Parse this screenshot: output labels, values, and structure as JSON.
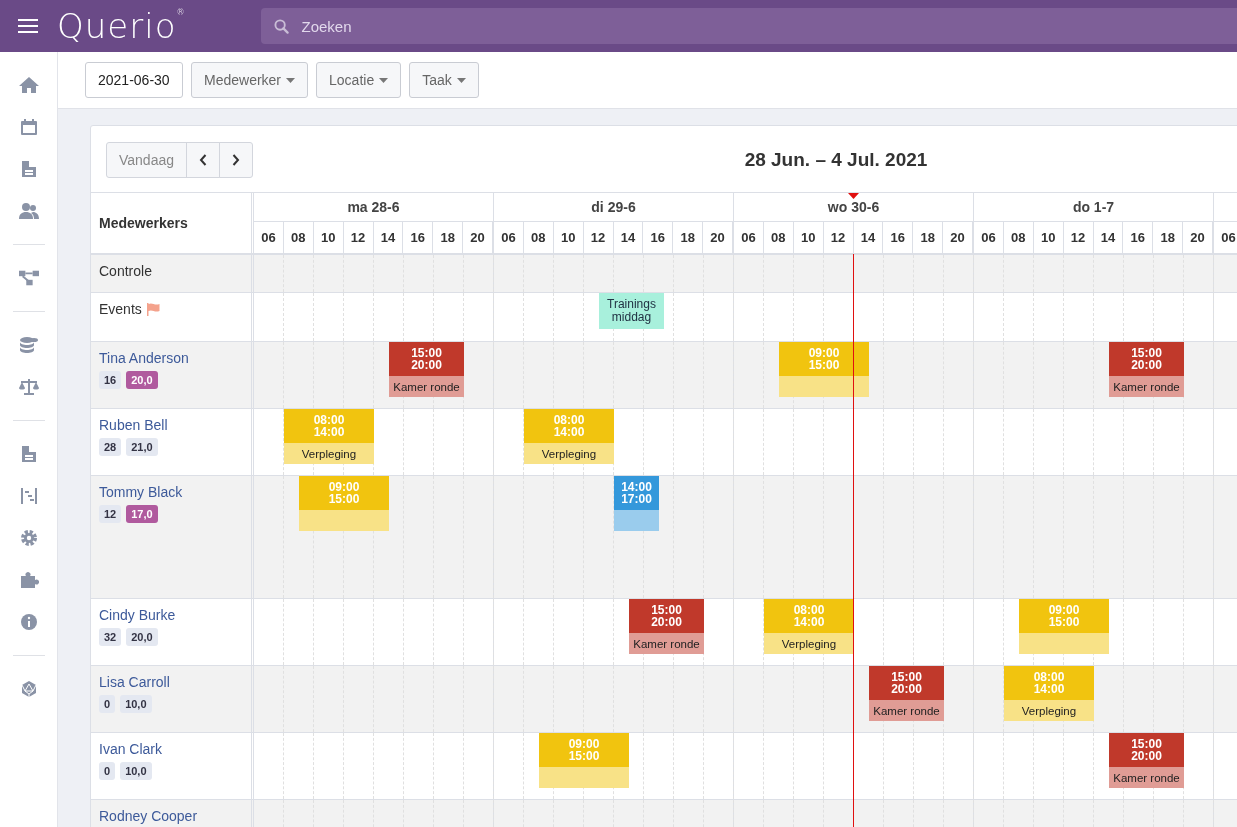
{
  "header": {
    "logo": "Querio$^{®}$",
    "search": {
      "placeholder": "Zoeken"
    }
  },
  "filters": {
    "date": "2021-06-30",
    "dropdowns": [
      "Medewerker",
      "Locatie",
      "Taak"
    ]
  },
  "calendar": {
    "today_button": "Vandaag",
    "title": "28 Jun. – 4 Jul. 2021",
    "name_column": "Medewerkers",
    "days": [
      {
        "label": "ma 28-6",
        "hours": [
          "06",
          "08",
          "10",
          "12",
          "14",
          "16",
          "18",
          "20"
        ]
      },
      {
        "label": "di 29-6",
        "hours": [
          "06",
          "08",
          "10",
          "12",
          "14",
          "16",
          "18",
          "20"
        ]
      },
      {
        "label": "wo 30-6",
        "hours": [
          "06",
          "08",
          "10",
          "12",
          "14",
          "16",
          "18",
          "20"
        ]
      },
      {
        "label": "do 1-7",
        "hours": [
          "06",
          "08",
          "10",
          "12",
          "14",
          "16",
          "18",
          "20"
        ]
      },
      {
        "hours": [
          "06"
        ]
      }
    ],
    "rows": [
      {
        "kind": "plain",
        "name": "Controle"
      },
      {
        "kind": "events",
        "name": "Events",
        "days": [
          {
            "kind": "free"
          },
          {
            "shifts": [
              {
                "kind": "event",
                "label": "Trainings middag",
                "color": "#a8f0dc"
              }
            ]
          }
        ]
      },
      {
        "kind": "employee",
        "name": "Tina Anderson",
        "expanded": false,
        "badges": [
          {
            "text": "16",
            "highlighted": false
          },
          {
            "text": "20,0",
            "highlighted": true
          }
        ],
        "days": [
          {
            "shifts": [
              {
                "kind": "shift",
                "start": "15:00",
                "end": "20:00",
                "task": "Kamer ronde",
                "color": "#c0392b"
              }
            ]
          },
          {
            "kind": "free"
          },
          {
            "shifts": [
              {
                "kind": "shift",
                "start": "09:00",
                "end": "15:00",
                "color": "#f1c40f"
              }
            ]
          },
          {
            "shifts": [
              {
                "kind": "shift",
                "start": "15:00",
                "end": "20:00",
                "task": "Kamer ronde",
                "color": "#c0392b"
              }
            ]
          }
        ]
      },
      {
        "kind": "employee",
        "name": "Ruben Bell",
        "expanded": false,
        "badges": [
          {
            "text": "28",
            "highlighted": false
          },
          {
            "text": "21,0",
            "highlighted": false
          }
        ],
        "days": [
          {
            "shifts": [
              {
                "kind": "shift",
                "start": "08:00",
                "end": "14:00",
                "task": "Verpleging",
                "color": "#f1c40f"
              }
            ]
          },
          {
            "shifts": [
              {
                "kind": "shift",
                "start": "08:00",
                "end": "14:00",
                "task": "Verpleging",
                "color": "#f1c40f"
              }
            ]
          }
        ]
      },
      {
        "kind": "employee",
        "name": "Tommy Black",
        "expanded": true,
        "badges": [
          {
            "text": "12",
            "highlighted": false
          },
          {
            "text": "17,0",
            "highlighted": true
          }
        ],
        "days": [
          {
            "shifts": [
              {
                "kind": "shift",
                "start": "09:00",
                "end": "15:00",
                "color": "#f1c40f"
              }
            ]
          },
          {
            "shifts": [
              {
                "kind": "shift",
                "start": "14:00",
                "end": "17:00",
                "color": "#3498db"
              }
            ]
          }
        ]
      },
      {
        "kind": "employee",
        "name": "Cindy Burke",
        "expanded": false,
        "badges": [
          {
            "text": "32",
            "highlighted": false
          },
          {
            "text": "20,0",
            "highlighted": false
          }
        ],
        "days": [
          {
            "kind": "free"
          },
          {
            "shifts": [
              {
                "kind": "shift",
                "start": "15:00",
                "end": "20:00",
                "task": "Kamer ronde",
                "color": "#c0392b"
              }
            ]
          },
          {
            "shifts": [
              {
                "kind": "shift",
                "start": "08:00",
                "end": "14:00",
                "task": "Verpleging",
                "color": "#f1c40f"
              }
            ]
          },
          {
            "shifts": [
              {
                "kind": "shift",
                "start": "09:00",
                "end": "15:00",
                "color": "#f1c40f"
              }
            ]
          }
        ]
      },
      {
        "kind": "employee",
        "name": "Lisa Carroll",
        "expanded": false,
        "badges": [
          {
            "text": "0",
            "highlighted": false
          },
          {
            "text": "10,0",
            "highlighted": false
          }
        ],
        "days": [
          {
            "kind": "free"
          },
          {
            "kind": "free"
          },
          {
            "shifts": [
              {
                "kind": "shift",
                "start": "15:00",
                "end": "20:00",
                "task": "Kamer ronde",
                "color": "#c0392b"
              }
            ]
          },
          {
            "shifts": [
              {
                "kind": "shift",
                "start": "08:00",
                "end": "14:00",
                "task": "Verpleging",
                "color": "#f1c40f"
              }
            ]
          }
        ]
      },
      {
        "kind": "employee",
        "name": "Ivan Clark",
        "expanded": false,
        "badges": [
          {
            "text": "0",
            "highlighted": false
          },
          {
            "text": "10,0",
            "highlighted": false
          }
        ],
        "days": [
          {
            "kind": "free"
          },
          {
            "shifts": [
              {
                "kind": "shift",
                "start": "09:00",
                "end": "15:00",
                "color": "#f1c40f"
              }
            ]
          },
          {
            "kind": "free"
          },
          {
            "shifts": [
              {
                "kind": "shift",
                "start": "15:00",
                "end": "20:00",
                "task": "Kamer ronde",
                "color": "#c0392b"
              }
            ]
          }
        ]
      },
      {
        "kind": "employee",
        "name": "Rodney Cooper",
        "expanded": false
      }
    ]
  }
}
